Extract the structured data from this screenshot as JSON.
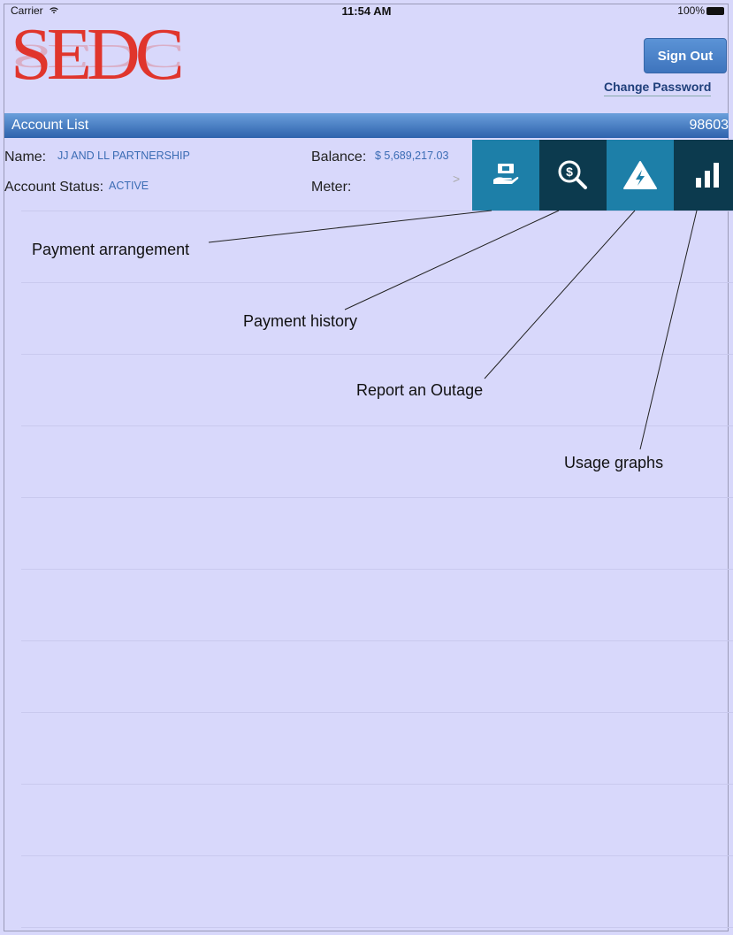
{
  "status_bar": {
    "carrier": "Carrier",
    "time": "11:54 AM",
    "battery": "100%"
  },
  "logo": {
    "text": "SEDC"
  },
  "header": {
    "sign_out": "Sign Out",
    "change_password": "Change Password"
  },
  "account_list": {
    "title": "Account List",
    "account_number": "98603"
  },
  "account": {
    "name_label": "Name:",
    "name_value": "JJ AND LL PARTNERSHIP",
    "status_label": "Account Status:",
    "status_value": "ACTIVE",
    "balance_label": "Balance:",
    "balance_value": "$ 5,689,217.03",
    "meter_label": "Meter:",
    "meter_value": "",
    "chevron": ">"
  },
  "actions": [
    {
      "icon": "payment-arrangement-icon",
      "color": "#1d7fa8"
    },
    {
      "icon": "payment-history-icon",
      "color": "#0c3a4e"
    },
    {
      "icon": "outage-icon",
      "color": "#1d7fa8"
    },
    {
      "icon": "usage-graph-icon",
      "color": "#0c3a4e"
    }
  ],
  "callouts": {
    "payment_arrangement": "Payment arrangement",
    "payment_history": "Payment history",
    "report_outage": "Report an Outage",
    "usage_graphs": "Usage graphs"
  },
  "colors": {
    "background": "#d8d8fb",
    "logo_red": "#e0352c",
    "bar_blue": "#2e62ad"
  }
}
